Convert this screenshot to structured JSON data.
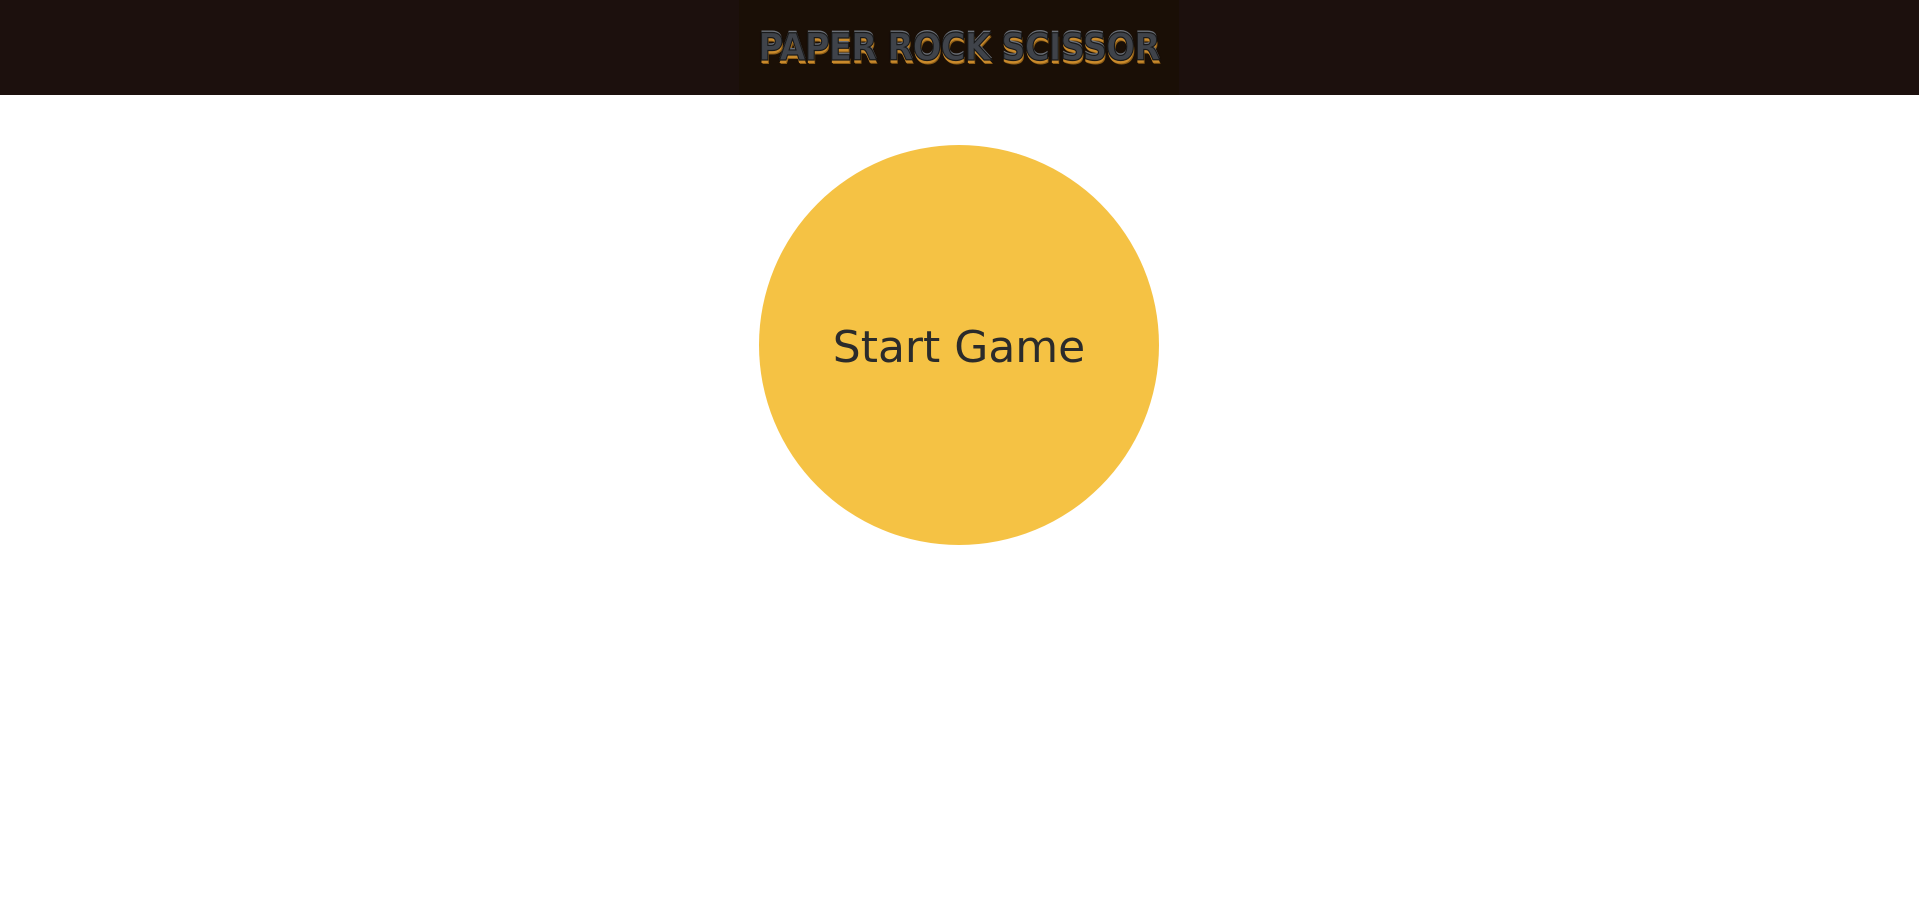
{
  "header": {
    "logo_text": "PAPER ROCK SCISSOR",
    "colors": {
      "bar": "#1c100d",
      "logo_panel": "#1a0f06",
      "logo_fill": "#3f434a",
      "logo_outline": "#c98a2c"
    }
  },
  "main": {
    "start_button_label": "Start Game",
    "colors": {
      "button": "#f5c244",
      "button_text": "#2b2b2b",
      "background": "#ffffff"
    }
  }
}
